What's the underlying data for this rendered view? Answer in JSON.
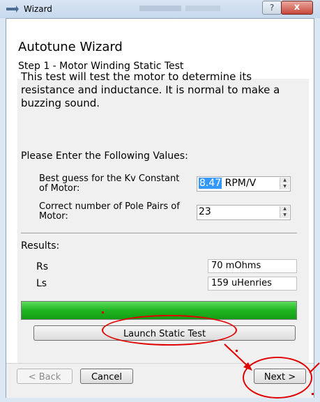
{
  "window": {
    "title": "Wizard",
    "help_glyph": "?",
    "close_glyph": "x",
    "icon": "wizard-window-icon"
  },
  "wizard": {
    "heading": "Autotune Wizard",
    "step": "Step 1 - Motor Winding Static Test",
    "description": "This test will test the motor to determine its resistance and inductance. It is normal to make a buzzing sound.",
    "prompt": "Please Enter the Following Values:",
    "kv_label": "Best guess for the Kv Constant of Motor:",
    "kv_value": "8.47",
    "kv_unit": " RPM/V",
    "pole_label": "Correct number of Pole Pairs of Motor:",
    "pole_value": "23",
    "results_label": "Results:",
    "rs_label": "Rs",
    "rs_value": "70 mOhms",
    "ls_label": "Ls",
    "ls_value": "159 uHenries",
    "progress": 1.0,
    "launch_button": "Launch Static Test"
  },
  "footer": {
    "back_button": "< Back",
    "cancel_button": "Cancel",
    "next_button": "Next >"
  },
  "colors": {
    "progress_fill": "#22b822",
    "annotation": "#e00000",
    "selection": "#3399ff"
  }
}
